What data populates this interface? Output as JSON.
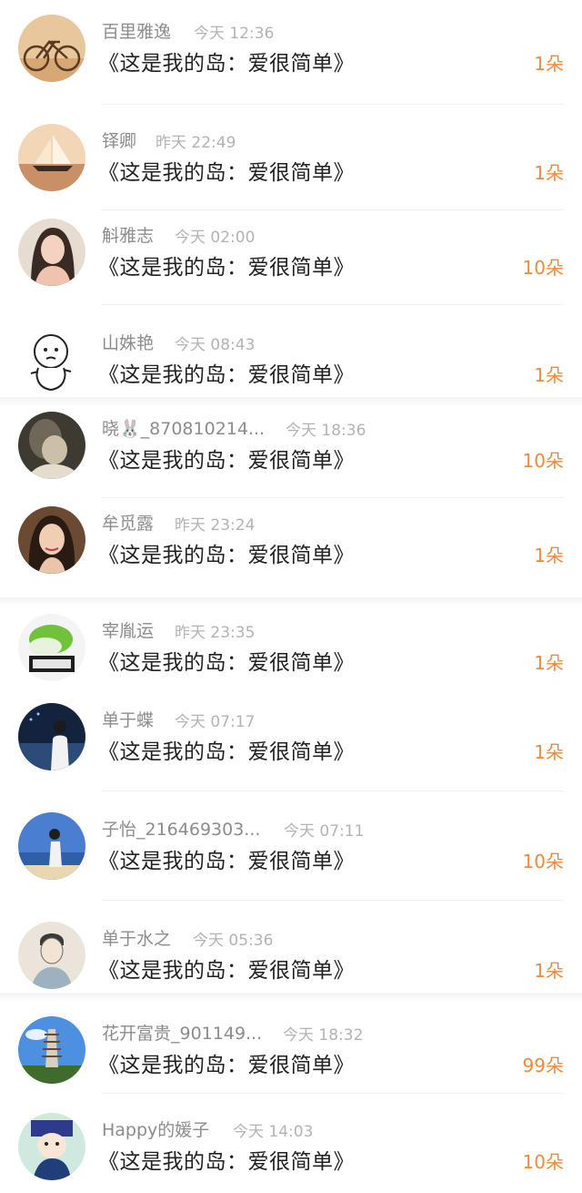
{
  "gift_list": {
    "items": [
      {
        "name": "百里雅逸",
        "time": "今天 12:36",
        "title": "《这是我的岛：爱很简单》",
        "amount": "1朵",
        "avatar": "bicycle-photo"
      },
      {
        "name": "铎卿",
        "time": "昨天 22:49",
        "title": "《这是我的岛：爱很简单》",
        "amount": "1朵",
        "avatar": "sailboat-sunset-photo"
      },
      {
        "name": "斛雅志",
        "time": "今天 02:00",
        "title": "《这是我的岛：爱很简单》",
        "amount": "10朵",
        "avatar": "woman-portrait-photo"
      },
      {
        "name": "山姝艳",
        "time": "今天 08:43",
        "title": "《这是我的岛：爱很简单》",
        "amount": "1朵",
        "avatar": "cartoon-baby-sketch"
      },
      {
        "name": "晓🐰_870810214...",
        "time": "今天 18:36",
        "title": "《这是我的岛：爱很简单》",
        "amount": "10朵",
        "avatar": "hazy-portrait-photo"
      },
      {
        "name": "牟觅露",
        "time": "昨天 23:24",
        "title": "《这是我的岛：爱很简单》",
        "amount": "1朵",
        "avatar": "illustrated-girl"
      },
      {
        "name": "宰胤运",
        "time": "昨天 23:35",
        "title": "《这是我的岛：爱很简单》",
        "amount": "1朵",
        "avatar": "jade-cabbage-photo"
      },
      {
        "name": "单于蝶",
        "time": "今天 07:17",
        "title": "《这是我的岛：爱很简单》",
        "amount": "1朵",
        "avatar": "city-night-person"
      },
      {
        "name": "子怡_216469303...",
        "time": "今天 07:11",
        "title": "《这是我的岛：爱很简单》",
        "amount": "10朵",
        "avatar": "seaside-person"
      },
      {
        "name": "单于水之",
        "time": "今天 05:36",
        "title": "《这是我的岛：爱很简单》",
        "amount": "1朵",
        "avatar": "man-sketch"
      },
      {
        "name": "花开富贵_901149...",
        "time": "今天 18:32",
        "title": "《这是我的岛：爱很简单》",
        "amount": "99朵",
        "avatar": "pagoda-photo"
      },
      {
        "name": "Happy的媛子",
        "time": "今天 14:03",
        "title": "《这是我的岛：爱很简单》",
        "amount": "10朵",
        "avatar": "cartoon-character"
      }
    ]
  },
  "colors": {
    "name": "#8c8c8c",
    "time": "#b3b3b3",
    "title": "#222222",
    "amount": "#f08a3c",
    "separator": "#f1f1f1"
  }
}
